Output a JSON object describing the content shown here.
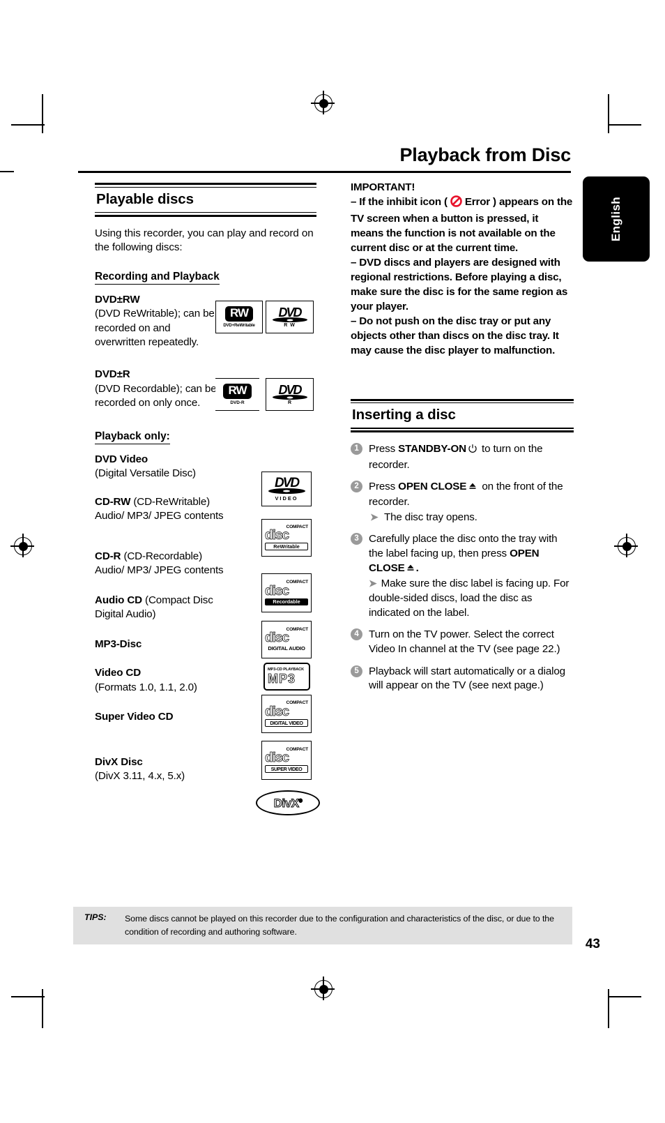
{
  "page": {
    "title": "Playback from Disc",
    "number": "43",
    "language_tab": "English"
  },
  "left_column": {
    "section_title": "Playable discs",
    "intro": "Using this recorder, you can play and record on the following discs:",
    "recording_heading": "Recording and Playback",
    "playback_heading": "Playback only:",
    "recording_discs": [
      {
        "name": "DVD±RW",
        "desc": "(DVD ReWritable); can be recorded on and overwritten repeatedly.",
        "logos": [
          "dvd-plus-rewritable-logo",
          "dvd-rw-logo"
        ]
      },
      {
        "name": "DVD±R",
        "desc": "(DVD Recordable); can be recorded on only once.",
        "logos": [
          "dvd-plus-r-logo",
          "dvd-r-logo"
        ]
      }
    ],
    "playback_discs": [
      {
        "name": "DVD Video",
        "desc": "(Digital Versatile Disc)",
        "logo": "dvd-video-logo",
        "logo_top": "VIDEO"
      },
      {
        "name": "CD-RW",
        "desc": " (CD-ReWritable)",
        "desc2": "Audio/ MP3/ JPEG contents",
        "logo": "compact-disc-rewritable-logo",
        "logo_top": "COMPACT",
        "logo_bottom": "ReWritable"
      },
      {
        "name": "CD-R",
        "desc": " (CD-Recordable)",
        "desc2": "Audio/ MP3/ JPEG contents",
        "logo": "compact-disc-recordable-logo",
        "logo_top": "COMPACT",
        "logo_bottom": "Recordable"
      },
      {
        "name": "Audio CD",
        "desc": " (Compact Disc",
        "desc2": "Digital Audio)",
        "logo": "compact-disc-digital-audio-logo",
        "logo_top": "COMPACT",
        "logo_bottom": "DIGITAL AUDIO"
      },
      {
        "name": "MP3-Disc",
        "desc": "",
        "logo": "mp3-cd-playback-logo",
        "logo_top": "MP3-CD PLAYBACK",
        "logo_bottom": "MP3"
      },
      {
        "name": "Video CD",
        "desc": "(Formats 1.0, 1.1, 2.0)",
        "logo": "compact-disc-digital-video-logo",
        "logo_top": "COMPACT",
        "logo_bottom": "DIGITAL VIDEO"
      },
      {
        "name": "Super Video CD",
        "desc": "",
        "logo": "compact-disc-super-video-logo",
        "logo_top": "COMPACT",
        "logo_bottom": "SUPER VIDEO"
      },
      {
        "name": "DivX Disc",
        "desc": "(DivX 3.11, 4.x, 5.x)",
        "logo": "divx-logo",
        "logo_bottom": "DivX"
      }
    ]
  },
  "right_column": {
    "important_title": "IMPORTANT!",
    "important_items": [
      {
        "dash": "–",
        "before_icon": " If the inhibit icon ( ",
        "icon": "inhibit-error-icon",
        "after_icon": " Error )",
        "rest": "appears on the TV screen when a button is pressed, it means the function is not available on the current disc or at the current time."
      },
      {
        "dash": "–",
        "text": " DVD discs and players are designed with regional restrictions. Before playing a disc, make sure the disc is for the same region as your player."
      },
      {
        "dash": "–",
        "text": " Do not push on the disc tray or put any objects other than discs on the disc tray. It may cause the disc player to malfunction."
      }
    ],
    "section_title": "Inserting a disc",
    "steps": [
      {
        "num": "1",
        "pre": "Press ",
        "bold": "STANDBY-ON",
        "icon": "power-standby-icon",
        "post": " to turn on the recorder."
      },
      {
        "num": "2",
        "pre": "Press ",
        "bold": "OPEN CLOSE",
        "icon": "eject-icon",
        "post": " on the front of the recorder.",
        "sub": "The disc tray opens."
      },
      {
        "num": "3",
        "pre": "Carefully place the disc onto the tray with the label facing up, then press ",
        "bold": "OPEN CLOSE",
        "icon": "eject-icon",
        "post": ".",
        "sub": "Make sure the disc label is facing up. For double-sided discs, load the disc as indicated on the label."
      },
      {
        "num": "4",
        "text": "Turn on the TV power. Select the correct Video In channel at the TV (see page 22.)"
      },
      {
        "num": "5",
        "text": "Playback will start automatically or a dialog will appear on the TV (see next page.)"
      }
    ]
  },
  "footer": {
    "tips_label": "TIPS:",
    "tips_text": "Some discs cannot be played on this recorder due to the configuration and characteristics of the disc, or due to the condition of recording and authoring software."
  },
  "colors": {
    "error_icon": "#e8122b",
    "step_badge": "#9a9a9a",
    "tips_background": "#e0e0e0"
  }
}
